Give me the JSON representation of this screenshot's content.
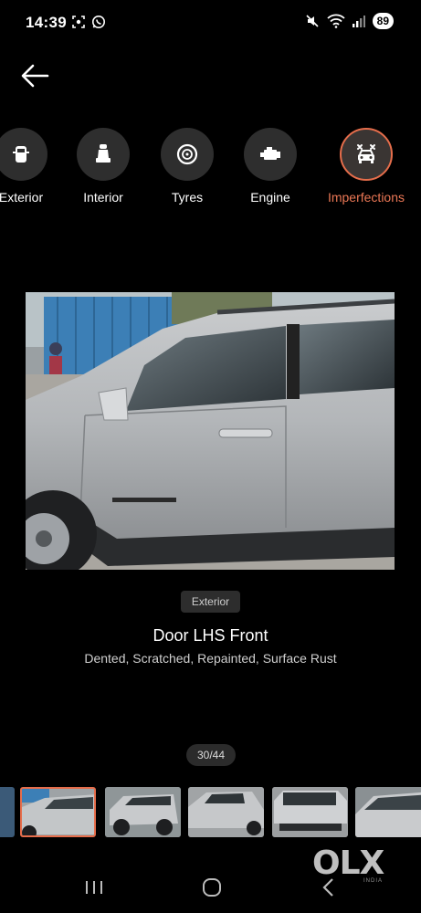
{
  "status_bar": {
    "time": "14:39",
    "battery": "89"
  },
  "categories": [
    {
      "label": "Exterior",
      "icon": "car-exterior-icon",
      "active": false
    },
    {
      "label": "Interior",
      "icon": "car-seat-icon",
      "active": false
    },
    {
      "label": "Tyres",
      "icon": "tyre-icon",
      "active": false
    },
    {
      "label": "Engine",
      "icon": "engine-icon",
      "active": false
    },
    {
      "label": "Imperfections",
      "icon": "car-repair-icon",
      "active": true
    }
  ],
  "image": {
    "chip": "Exterior",
    "title": "Door LHS Front",
    "subtitle": "Dented, Scratched, Repainted, Surface Rust",
    "counter": "30/44"
  },
  "watermark": {
    "brand": "OLX",
    "sub": "INDIA"
  },
  "colors": {
    "accent": "#e56d4b",
    "background": "#000000"
  }
}
